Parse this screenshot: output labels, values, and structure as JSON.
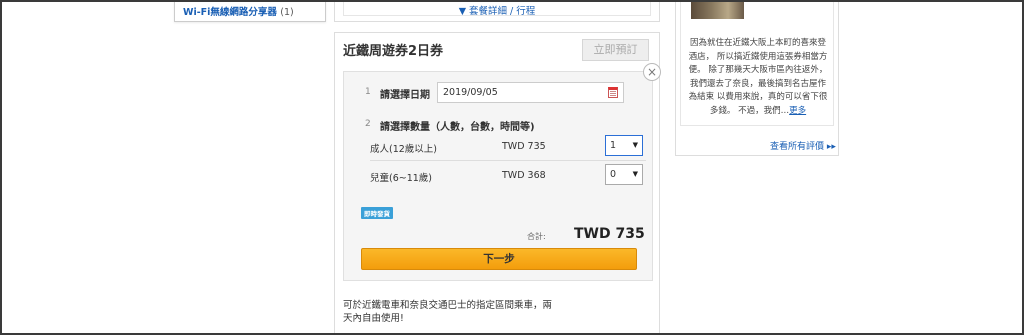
{
  "sidebar": {
    "category_link": "Wi-Fi無線網路分享器",
    "category_count": "(1)"
  },
  "prev_package": {
    "details_link": "▼ 套餐詳細 / 行程"
  },
  "package": {
    "title": "近鐵周遊券2日券",
    "book_now": "立即預訂",
    "close_symbol": "×",
    "step1": {
      "num": "1",
      "label": "請選擇日期",
      "date_value": "2019/09/05"
    },
    "step2": {
      "num": "2",
      "label": "請選擇數量（人數，台數，時間等)",
      "rows": [
        {
          "label": "成人(12歲以上)",
          "price": "TWD 735",
          "qty": "1"
        },
        {
          "label": "兒童(6~11歲)",
          "price": "TWD 368",
          "qty": "0"
        }
      ]
    },
    "badge": "即時發貨",
    "total_label": "合計:",
    "total_value": "TWD 735",
    "next_button": "下一步",
    "description": "可於近鐵電車和奈良交通巴士的指定區間乘車，兩天內自由使用!"
  },
  "review": {
    "text": "因為就住在近鐵大阪上本町的喜來登酒店， 所以搞近鐵使用這張券相當方便。 除了那幾天大阪市區內往返外，我們還去了奈良，最後搞到名古屋作為結束 以費用來說，真的可以省下很多錢。 不過，我們…",
    "more_link": "更多",
    "all_reviews_link": "查看所有評價 ▸▸"
  },
  "colors": {
    "link": "#1a5fb4",
    "cta": "#f39d0c",
    "badge": "#3aa0d8"
  }
}
